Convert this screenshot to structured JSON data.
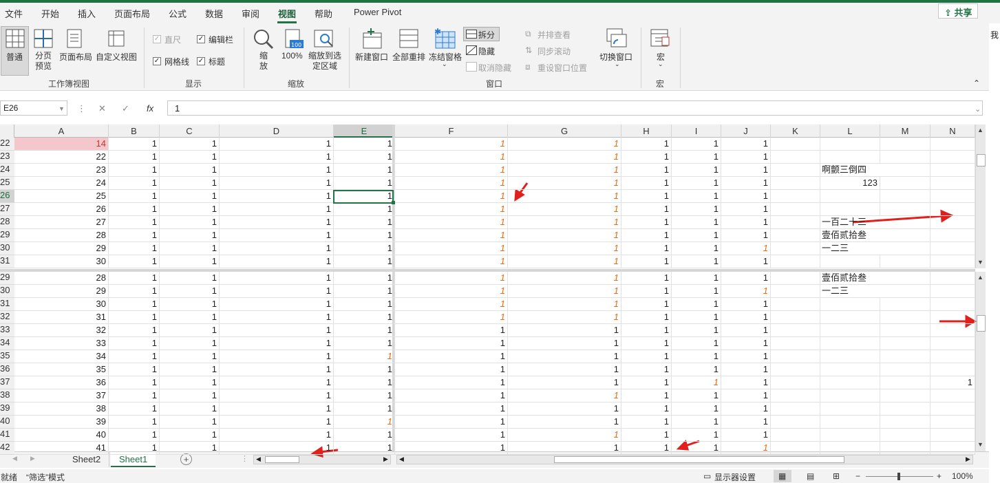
{
  "menu": {
    "items": [
      "文件",
      "开始",
      "插入",
      "页面布局",
      "公式",
      "数据",
      "审阅",
      "视图",
      "帮助",
      "Power Pivot"
    ],
    "active": "视图",
    "share_label": "共享"
  },
  "ribbon": {
    "workbook_views": {
      "group_label": "工作簿视图",
      "normal": "普通",
      "page_break": "分页预览",
      "page_layout": "页面布局",
      "custom": "自定义视图"
    },
    "show": {
      "group_label": "显示",
      "ruler": "直尺",
      "formula_bar": "编辑栏",
      "gridlines": "网格线",
      "headings": "标题"
    },
    "zoom": {
      "group_label": "缩放",
      "zoom": "缩放",
      "zoom100": "100%",
      "zoom_selection": "缩放到选定区域"
    },
    "window": {
      "group_label": "窗口",
      "new_window": "新建窗口",
      "arrange_all": "全部重排",
      "freeze": "冻结窗格",
      "split": "拆分",
      "hide": "隐藏",
      "unhide": "取消隐藏",
      "side_by_side": "并排查看",
      "sync_scroll": "同步滚动",
      "reset_pos": "重设窗口位置",
      "switch": "切换窗口"
    },
    "macros": {
      "group_label": "宏",
      "macros": "宏"
    }
  },
  "formula_bar": {
    "name_box": "E26",
    "value": "1",
    "fx": "fx"
  },
  "columns": [
    "A",
    "B",
    "C",
    "D",
    "E",
    "F",
    "G",
    "H",
    "I",
    "J",
    "K",
    "L",
    "M",
    "N"
  ],
  "selected_column": "E",
  "selected_row": "26",
  "pane_top": {
    "rows": [
      {
        "r": "22",
        "A": "14",
        "B": "1",
        "C": "1",
        "D": "1",
        "E": "1",
        "F": "1",
        "G": "1",
        "H": "1",
        "I": "1",
        "J": "1",
        "L": ""
      },
      {
        "r": "23",
        "A": "22",
        "B": "1",
        "C": "1",
        "D": "1",
        "E": "1",
        "F": "1",
        "G": "1",
        "H": "1",
        "I": "1",
        "J": "1",
        "L": ""
      },
      {
        "r": "24",
        "A": "23",
        "B": "1",
        "C": "1",
        "D": "1",
        "E": "1",
        "F": "1",
        "G": "1",
        "H": "1",
        "I": "1",
        "J": "1",
        "L": "啊颤三倒四"
      },
      {
        "r": "25",
        "A": "24",
        "B": "1",
        "C": "1",
        "D": "1",
        "E": "1",
        "F": "1",
        "G": "1",
        "H": "1",
        "I": "1",
        "J": "1",
        "L": "123"
      },
      {
        "r": "26",
        "A": "25",
        "B": "1",
        "C": "1",
        "D": "1",
        "E": "1",
        "F": "1",
        "G": "1",
        "H": "1",
        "I": "1",
        "J": "1",
        "L": ""
      },
      {
        "r": "27",
        "A": "26",
        "B": "1",
        "C": "1",
        "D": "1",
        "E": "1",
        "F": "1",
        "G": "1",
        "H": "1",
        "I": "1",
        "J": "1",
        "L": ""
      },
      {
        "r": "28",
        "A": "27",
        "B": "1",
        "C": "1",
        "D": "1",
        "E": "1",
        "F": "1",
        "G": "1",
        "H": "1",
        "I": "1",
        "J": "1",
        "L": "一百二十三"
      },
      {
        "r": "29",
        "A": "28",
        "B": "1",
        "C": "1",
        "D": "1",
        "E": "1",
        "F": "1",
        "G": "1",
        "H": "1",
        "I": "1",
        "J": "1",
        "L": "壹佰贰拾叁"
      },
      {
        "r": "30",
        "A": "29",
        "B": "1",
        "C": "1",
        "D": "1",
        "E": "1",
        "F": "1",
        "G": "1",
        "H": "1",
        "I": "1",
        "J": "1",
        "L": "一二三"
      },
      {
        "r": "31",
        "A": "30",
        "B": "1",
        "C": "1",
        "D": "1",
        "E": "1",
        "F": "1",
        "G": "1",
        "H": "1",
        "I": "1",
        "J": "1",
        "L": ""
      }
    ]
  },
  "pane_bottom": {
    "rows": [
      {
        "r": "29",
        "A": "28",
        "B": "1",
        "C": "1",
        "D": "1",
        "E": "1",
        "F": "1",
        "G": "1",
        "H": "1",
        "I": "1",
        "J": "1",
        "L": "壹佰贰拾叁",
        "N": ""
      },
      {
        "r": "30",
        "A": "29",
        "B": "1",
        "C": "1",
        "D": "1",
        "E": "1",
        "F": "1",
        "G": "1",
        "H": "1",
        "I": "1",
        "J": "1",
        "L": "一二三",
        "N": ""
      },
      {
        "r": "31",
        "A": "30",
        "B": "1",
        "C": "1",
        "D": "1",
        "E": "1",
        "F": "1",
        "G": "1",
        "H": "1",
        "I": "1",
        "J": "1",
        "L": "",
        "N": ""
      },
      {
        "r": "32",
        "A": "31",
        "B": "1",
        "C": "1",
        "D": "1",
        "E": "1",
        "F": "1",
        "G": "1",
        "H": "1",
        "I": "1",
        "J": "1",
        "L": "",
        "N": ""
      },
      {
        "r": "33",
        "A": "32",
        "B": "1",
        "C": "1",
        "D": "1",
        "E": "1",
        "F": "1",
        "G": "1",
        "H": "1",
        "I": "1",
        "J": "1",
        "L": "",
        "N": ""
      },
      {
        "r": "34",
        "A": "33",
        "B": "1",
        "C": "1",
        "D": "1",
        "E": "1",
        "F": "1",
        "G": "1",
        "H": "1",
        "I": "1",
        "J": "1",
        "L": "",
        "N": ""
      },
      {
        "r": "35",
        "A": "34",
        "B": "1",
        "C": "1",
        "D": "1",
        "E": "1",
        "F": "1",
        "G": "1",
        "H": "1",
        "I": "1",
        "J": "1",
        "L": "",
        "N": ""
      },
      {
        "r": "36",
        "A": "35",
        "B": "1",
        "C": "1",
        "D": "1",
        "E": "1",
        "F": "1",
        "G": "1",
        "H": "1",
        "I": "1",
        "J": "1",
        "L": "",
        "N": ""
      },
      {
        "r": "37",
        "A": "36",
        "B": "1",
        "C": "1",
        "D": "1",
        "E": "1",
        "F": "1",
        "G": "1",
        "H": "1",
        "I": "1",
        "J": "1",
        "L": "",
        "N": "1"
      },
      {
        "r": "38",
        "A": "37",
        "B": "1",
        "C": "1",
        "D": "1",
        "E": "1",
        "F": "1",
        "G": "1",
        "H": "1",
        "I": "1",
        "J": "1",
        "L": "",
        "N": ""
      },
      {
        "r": "39",
        "A": "38",
        "B": "1",
        "C": "1",
        "D": "1",
        "E": "1",
        "F": "1",
        "G": "1",
        "H": "1",
        "I": "1",
        "J": "1",
        "L": "",
        "N": ""
      },
      {
        "r": "40",
        "A": "39",
        "B": "1",
        "C": "1",
        "D": "1",
        "E": "1",
        "F": "1",
        "G": "1",
        "H": "1",
        "I": "1",
        "J": "1",
        "L": "",
        "N": ""
      },
      {
        "r": "41",
        "A": "40",
        "B": "1",
        "C": "1",
        "D": "1",
        "E": "1",
        "F": "1",
        "G": "1",
        "H": "1",
        "I": "1",
        "J": "1",
        "L": "",
        "N": ""
      },
      {
        "r": "42",
        "A": "41",
        "B": "1",
        "C": "1",
        "D": "1",
        "E": "1",
        "F": "1",
        "G": "1",
        "H": "1",
        "I": "1",
        "J": "1",
        "L": "",
        "N": ""
      }
    ]
  },
  "sheets": {
    "tabs": [
      "Sheet2",
      "Sheet1"
    ],
    "active": "Sheet1",
    "add_label": "+"
  },
  "status": {
    "ready": "就绪",
    "filter_mode": "“筛选”模式",
    "display_settings": "显示器设置",
    "zoom": "100%",
    "zoom_minus": "−",
    "zoom_plus": "+"
  },
  "side_text": "我",
  "colors": {
    "accent": "#217346",
    "italic_orange": "#e46b0e",
    "annotation_red": "#e0201c",
    "highlight_pink": "#f4c7cc"
  }
}
